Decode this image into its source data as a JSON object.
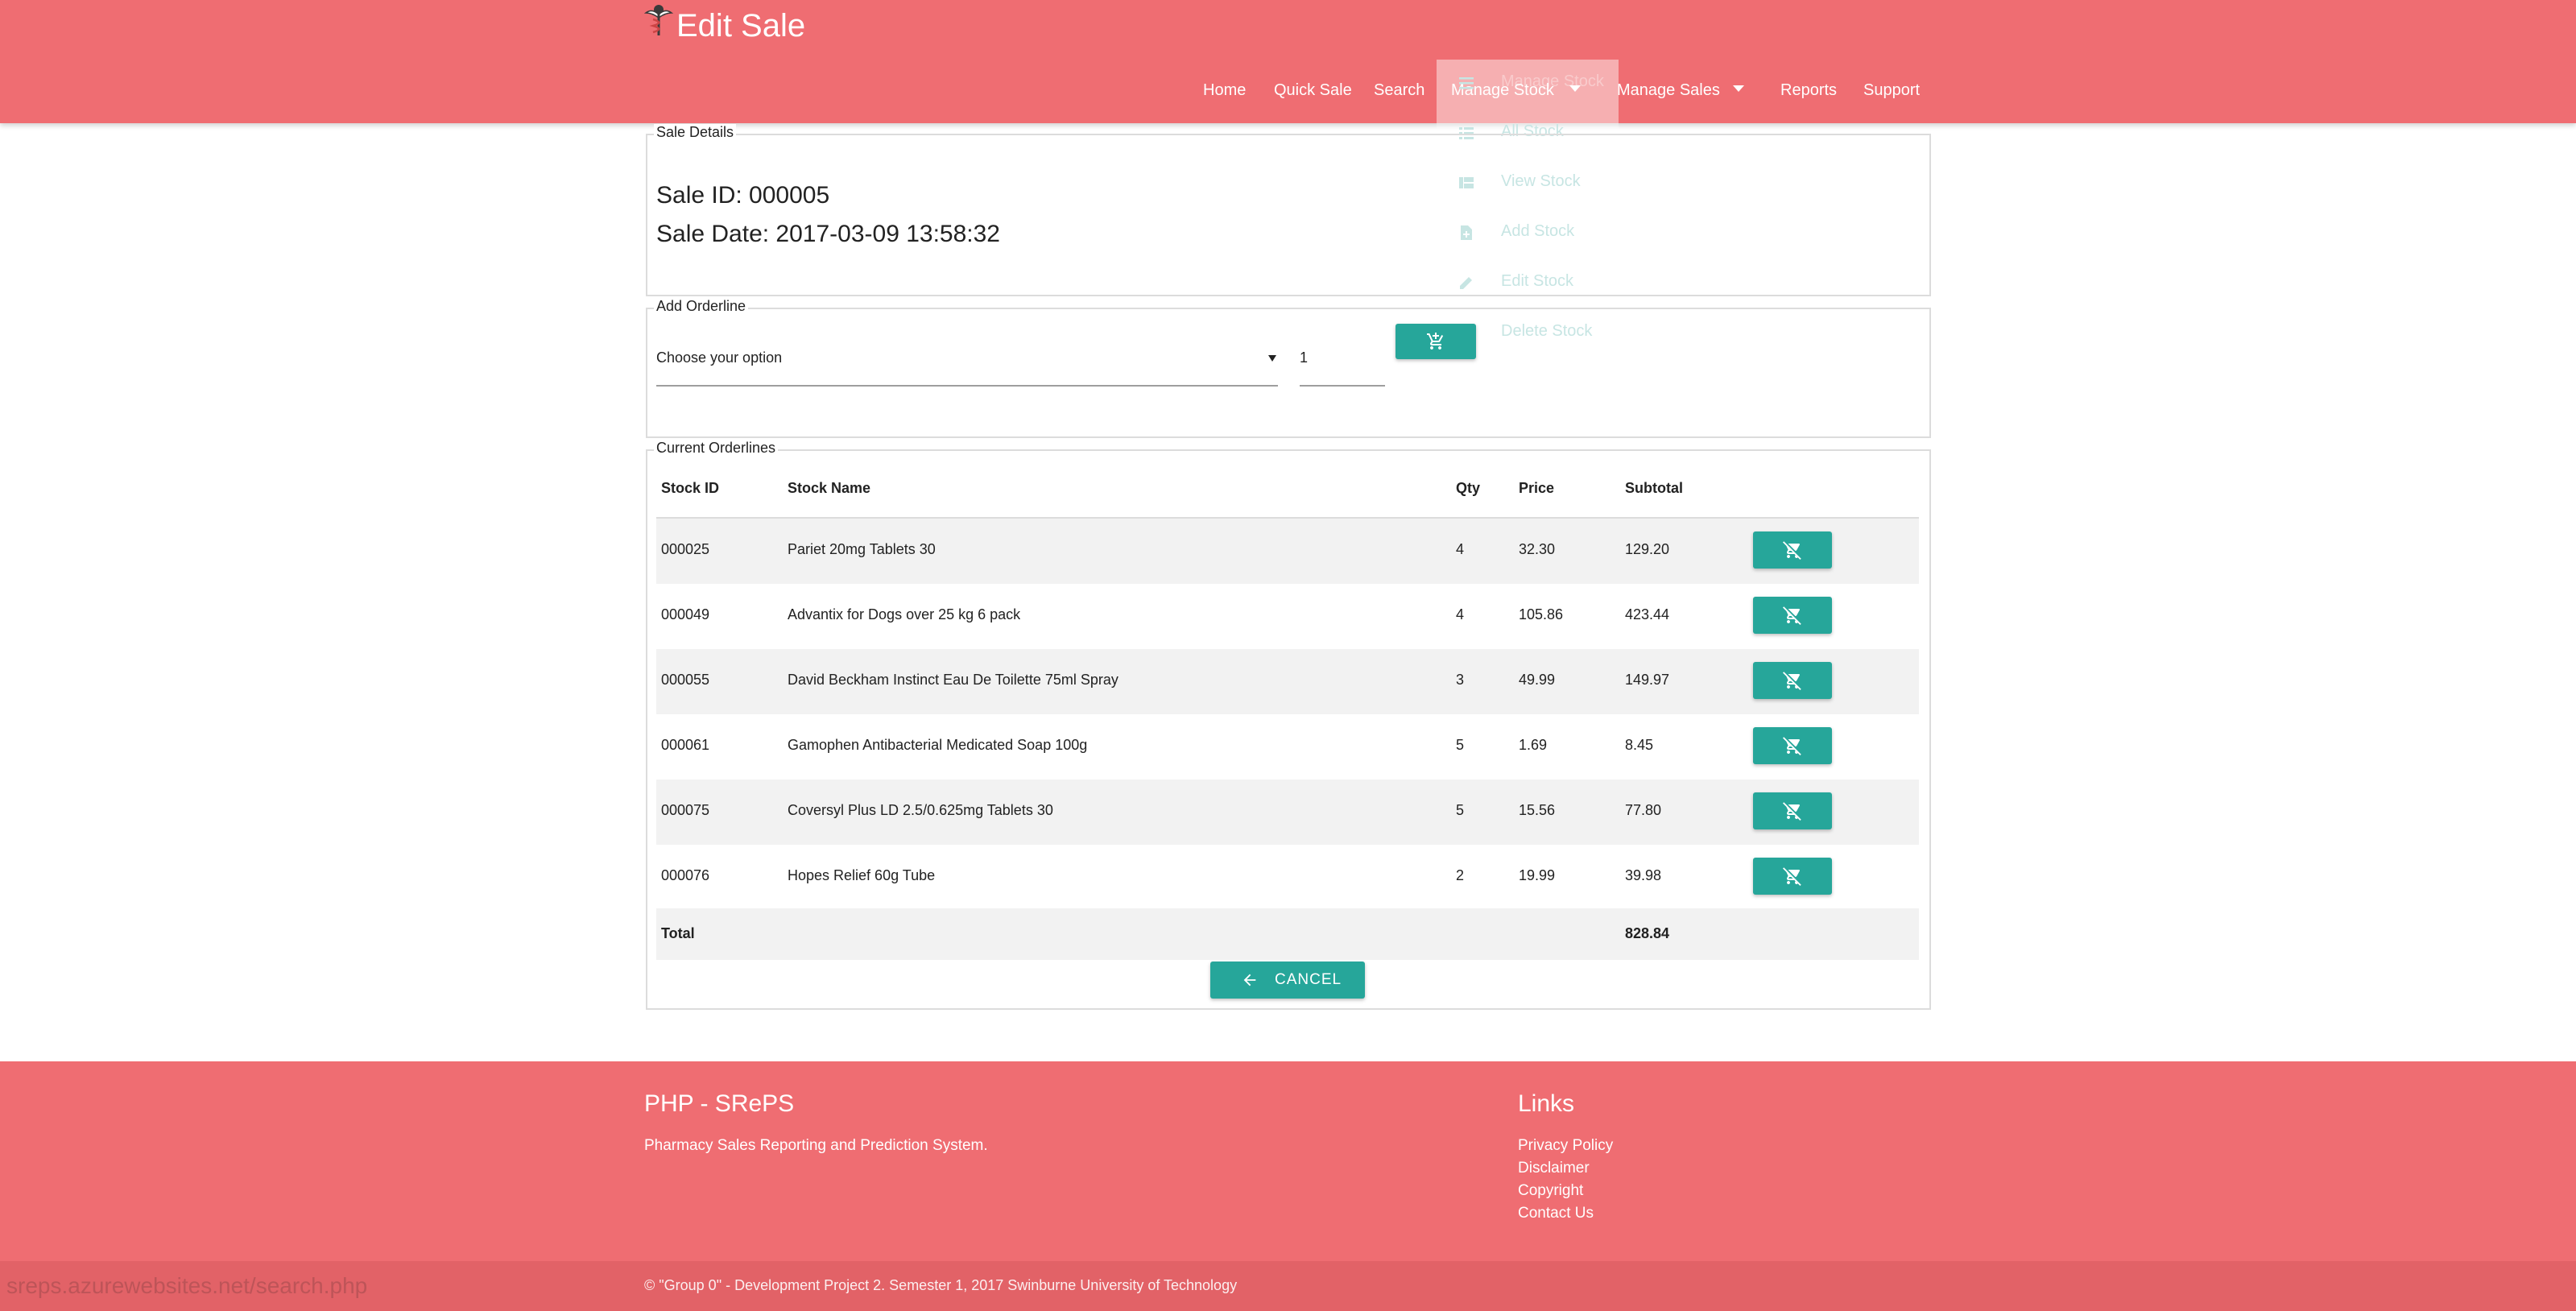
{
  "header": {
    "title": "Edit Sale",
    "logo_icon": "caduceus-icon",
    "nav": {
      "home": "Home",
      "quick_sale": "Quick Sale",
      "search": "Search",
      "manage_stock": "Manage Stock",
      "manage_sales": "Manage Sales",
      "reports": "Reports",
      "support": "Support"
    }
  },
  "dropdown": {
    "items": [
      {
        "label": "Manage Stock",
        "icon": "menu-icon"
      },
      {
        "label": "All Stock",
        "icon": "list-icon"
      },
      {
        "label": "View Stock",
        "icon": "view-icon"
      },
      {
        "label": "Add Stock",
        "icon": "note-add-icon"
      },
      {
        "label": "Edit Stock",
        "icon": "pencil-icon"
      },
      {
        "label": "Delete Stock",
        "icon": "trash-icon"
      }
    ]
  },
  "sale_details": {
    "legend": "Sale Details",
    "sale_id": "Sale ID: 000005",
    "sale_date": "Sale Date: 2017-03-09 13:58:32"
  },
  "add_orderline": {
    "legend": "Add Orderline",
    "select_value": "Choose your option",
    "quantity": "1",
    "add_icon": "add-shopping-cart-icon"
  },
  "orderlines": {
    "legend": "Current Orderlines",
    "columns": [
      "Stock ID",
      "Stock Name",
      "Qty",
      "Price",
      "Subtotal"
    ],
    "rows": [
      {
        "id": "000025",
        "name": "Pariet 20mg Tablets 30",
        "qty": "4",
        "price": "32.30",
        "subtotal": "129.20"
      },
      {
        "id": "000049",
        "name": "Advantix for Dogs over 25 kg 6 pack",
        "qty": "4",
        "price": "105.86",
        "subtotal": "423.44"
      },
      {
        "id": "000055",
        "name": "David Beckham Instinct Eau De Toilette 75ml Spray",
        "qty": "3",
        "price": "49.99",
        "subtotal": "149.97"
      },
      {
        "id": "000061",
        "name": "Gamophen Antibacterial Medicated Soap 100g",
        "qty": "5",
        "price": "1.69",
        "subtotal": "8.45"
      },
      {
        "id": "000075",
        "name": "Coversyl Plus LD 2.5/0.625mg Tablets 30",
        "qty": "5",
        "price": "15.56",
        "subtotal": "77.80"
      },
      {
        "id": "000076",
        "name": "Hopes Relief 60g Tube",
        "qty": "2",
        "price": "19.99",
        "subtotal": "39.98"
      }
    ],
    "remove_icon": "remove-shopping-cart-icon",
    "total_label": "Total",
    "total_value": "828.84",
    "cancel_label": "CANCEL",
    "cancel_icon": "arrow-back-icon"
  },
  "footer": {
    "app_name": "PHP - SRePS",
    "description": "Pharmacy Sales Reporting and Prediction System.",
    "links_heading": "Links",
    "links": [
      "Privacy Policy",
      "Disclaimer",
      "Copyright",
      "Contact Us"
    ],
    "copyright": "© \"Group 0\" - Development Project 2. Semester 1, 2017 Swinburne University of Technology"
  },
  "status_bar_url": "sreps.azurewebsites.net/search.php",
  "colors": {
    "header_bg": "#ef6d72",
    "accent_teal": "#26a69a"
  }
}
